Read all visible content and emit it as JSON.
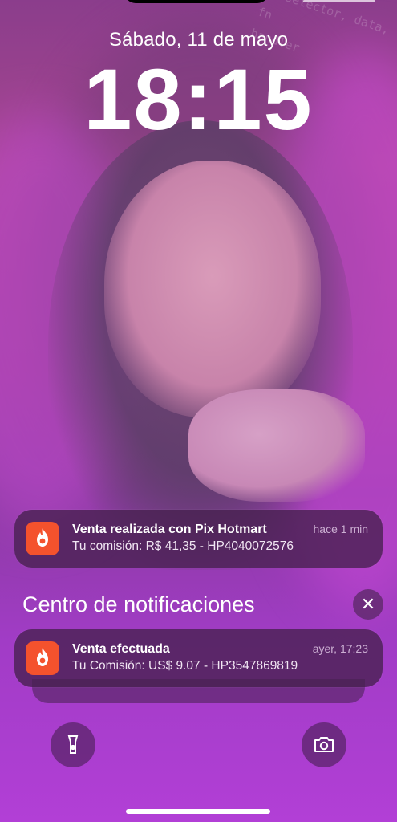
{
  "lockscreen": {
    "date": "Sábado, 11 de mayo",
    "time": "18:15"
  },
  "wallpaper": {
    "code_lines": [
      ";",
      "s, selector, data, fn",
      "",
      "",
      "handler"
    ]
  },
  "notifications": {
    "pinned": {
      "title": "Venta realizada con Pix Hotmart",
      "body": "Tu comisión: R$ 41,35 - HP4040072576",
      "time": "hace 1 min",
      "icon": "hotmart-flame-icon"
    },
    "center_title": "Centro de notificaciones",
    "close_icon": "close-icon",
    "items": [
      {
        "title": "Venta efectuada",
        "body": "Tu Comisión: US$ 9.07 - HP3547869819",
        "time": "ayer, 17:23",
        "icon": "hotmart-flame-icon"
      }
    ]
  },
  "quick_actions": {
    "left_icon": "flashlight-icon",
    "right_icon": "camera-icon"
  },
  "colors": {
    "hotmart": "#f4522d",
    "notification_bg": "#46204e"
  }
}
